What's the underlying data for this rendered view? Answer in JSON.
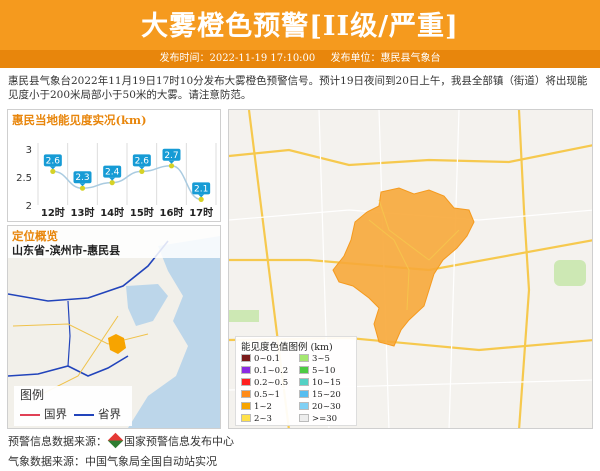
{
  "header": {
    "title": "大雾橙色预警[II级/严重]",
    "publish_time_label": "发布时间：2022-11-19 17:10:00",
    "publisher_label": "发布单位：惠民县气象台"
  },
  "description": "惠民县气象台2022年11月19日17时10分发布大雾橙色预警信号。预计19日夜间到20日上午，我县全部镇（街道）将出现能见度小于200米局部小于50米的大雾。请注意防范。",
  "chart_panel": {
    "title": "惠民当地能见度实况(km)"
  },
  "chart_data": {
    "type": "line",
    "categories": [
      "12时",
      "13时",
      "14时",
      "15时",
      "16时",
      "17时"
    ],
    "values": [
      2.6,
      2.3,
      2.4,
      2.6,
      2.7,
      2.1
    ],
    "ylim": [
      2,
      3
    ],
    "yticks": [
      "3",
      "2.5",
      "2"
    ],
    "grid": true,
    "colors": {
      "line": "#aacbe0",
      "marker": "#d6d226",
      "label_bg": "#169bd5"
    }
  },
  "location_panel": {
    "title": "定位概览",
    "path": "山东省-滨州市-惠民县",
    "legend_title": "图例",
    "legend_items": [
      {
        "label": "国界",
        "color": "#e04055"
      },
      {
        "label": "省界",
        "color": "#2244bb"
      }
    ]
  },
  "map_panel": {
    "legend_title": "能见度色值图例 (km)",
    "legend_items": [
      {
        "label": "0~0.1",
        "color": "#7a1a1a"
      },
      {
        "label": "0.1~0.2",
        "color": "#8a2be2"
      },
      {
        "label": "0.2~0.5",
        "color": "#ff2020"
      },
      {
        "label": "0.5~1",
        "color": "#ff8c1a"
      },
      {
        "label": "1~2",
        "color": "#f7a400"
      },
      {
        "label": "2~3",
        "color": "#ffe14a"
      },
      {
        "label": "3~5",
        "color": "#a4e870"
      },
      {
        "label": "5~10",
        "color": "#4ccb43"
      },
      {
        "label": "10~15",
        "color": "#53d1c4"
      },
      {
        "label": "15~20",
        "color": "#55bdf0"
      },
      {
        "label": "20~30",
        "color": "#7fd0f5"
      },
      {
        "label": ">=30",
        "color": "#ededed"
      }
    ],
    "warning_area_color": "#f7a83a"
  },
  "sources": {
    "warning_source": "预警信息数据来源：",
    "warning_source_name": "国家预警信息发布中心",
    "weather_source": "气象数据来源：中国气象局全国自动站实况"
  }
}
